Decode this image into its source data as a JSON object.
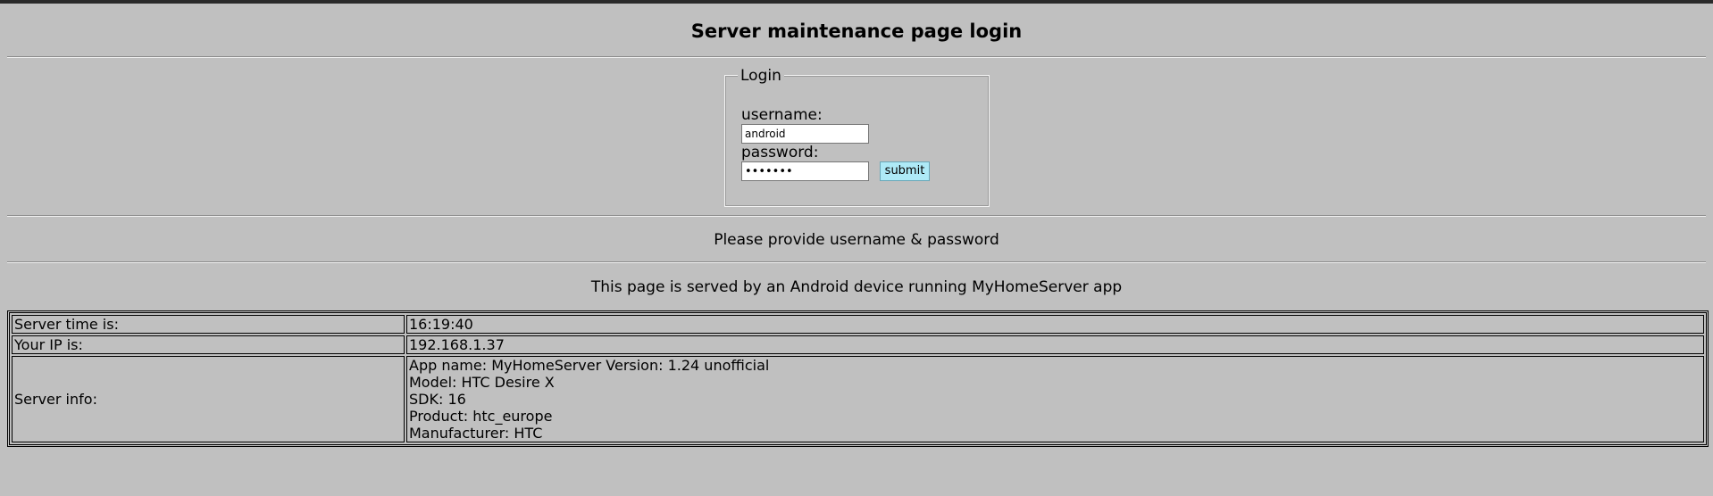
{
  "page": {
    "title": "Server maintenance page login"
  },
  "login": {
    "legend": "Login",
    "username_label": "username:",
    "username_value": "android",
    "password_label": "password:",
    "password_value": "•••••••",
    "submit_label": "submit"
  },
  "status_message": "Please provide username & password",
  "served_message": "This page is served by an Android device running MyHomeServer app",
  "info": {
    "server_time_label": "Server time is:",
    "server_time_value": "16:19:40",
    "ip_label": "Your IP is:",
    "ip_value": "192.168.1.37",
    "server_info_label": "Server info:",
    "server_info_lines": [
      "App name: MyHomeServer Version: 1.24 unofficial",
      "Model: HTC Desire X",
      "SDK: 16",
      "Product: htc_europe",
      "Manufacturer: HTC"
    ]
  },
  "colors": {
    "background": "#c0c0c0",
    "submit_button": "#aeeaf7"
  }
}
